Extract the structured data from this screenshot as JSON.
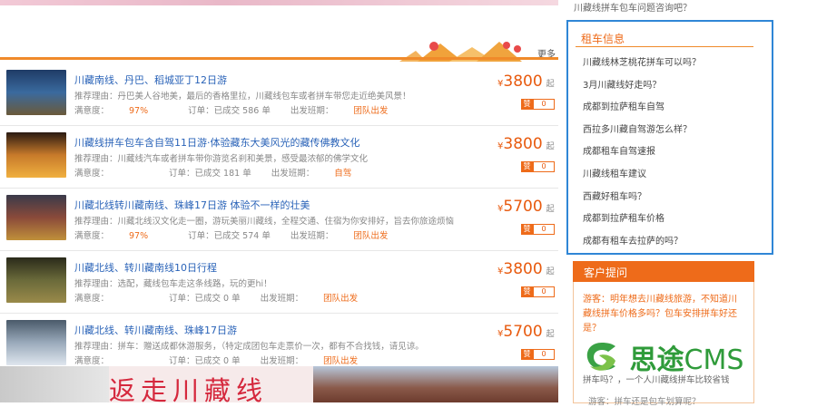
{
  "header": {
    "more": "更多"
  },
  "tours": [
    {
      "title": "川藏南线、丹巴、稻城亚丁12日游",
      "reason": "推荐理由：丹巴美人谷地美，最后的香格里拉，川藏线包车或者拼车带您走近绝美风景！",
      "rate_label": "满意度：",
      "rate": "97%",
      "order": "订单：已成交 586 单",
      "dept_label": "出发班期：",
      "dept": "团队出发",
      "price": "3800",
      "currency": "¥",
      "qi": "起",
      "zan": "赞",
      "likes": "0",
      "colors": [
        "#1f3b66",
        "#3a6a9e",
        "#6b5a3a"
      ]
    },
    {
      "title": "川藏线拼车包车含自驾11日游·体验藏东大美风光的藏传佛教文化",
      "reason": "推荐理由：川藏线汽车或者拼车带你游览名刹和美景，感受最浓郁的佛学文化",
      "rate_label": "满意度：",
      "rate": "",
      "order": "订单：已成交 181 单",
      "dept_label": "出发班期：",
      "dept": "自驾",
      "price": "3800",
      "currency": "¥",
      "qi": "起",
      "zan": "赞",
      "likes": "0",
      "colors": [
        "#2a1a12",
        "#c77a2a",
        "#f0b040"
      ]
    },
    {
      "title": "川藏北线转川藏南线、珠峰17日游 体验不一样的壮美",
      "reason": "推荐理由：川藏北线汉文化走一圈，游玩美丽川藏线，全程交通、住宿为你安排好，旨去你旅途烦恼",
      "rate_label": "满意度：",
      "rate": "97%",
      "order": "订单：已成交 574 单",
      "dept_label": "出发班期：",
      "dept": "团队出发",
      "price": "5700",
      "currency": "¥",
      "qi": "起",
      "zan": "赞",
      "likes": "0",
      "colors": [
        "#3a3a4a",
        "#8a4a3a",
        "#c0903a"
      ]
    },
    {
      "title": "川藏北线、转川藏南线10日行程",
      "reason": "推荐理由：选配，藏线包车走这条线路，玩的更hi！",
      "rate_label": "满意度：",
      "rate": "",
      "order": "订单：已成交 0 单",
      "dept_label": "出发班期：",
      "dept": "团队出发",
      "price": "3800",
      "currency": "¥",
      "qi": "起",
      "zan": "赞",
      "likes": "0",
      "colors": [
        "#2a2a1a",
        "#6a6a3a",
        "#9a8a4a"
      ]
    },
    {
      "title": "川藏北线、转川藏南线、珠峰17日游",
      "reason": "推荐理由：拼车：赠送成都休游服务，（特定成团包车走票价一次，都有不合找钱，请见谅。",
      "rate_label": "满意度：",
      "rate": "",
      "order": "订单：已成交 0 单",
      "dept_label": "出发班期：",
      "dept": "团队出发",
      "price": "5700",
      "currency": "¥",
      "qi": "起",
      "zan": "赞",
      "likes": "0",
      "colors": [
        "#4a5a6a",
        "#9aaabb",
        "#dfe6ee"
      ]
    }
  ],
  "banner": {
    "text": "返走川藏线"
  },
  "sidebar": {
    "top_text": "川藏线拼车包车问题咨询吧？",
    "rent_title": "租车信息",
    "rent_items": [
      "川藏线林芝桃花拼车可以吗？",
      "3月川藏线好走吗？",
      "成都到拉萨租车自驾",
      "西拉多川藏自驾游怎么样？",
      "成都租车自驾速报",
      "川藏线租车建议",
      "西藏好租车吗？",
      "成都到拉萨租车价格",
      "成都有租车去拉萨的吗？"
    ],
    "ask_title": "客户提问",
    "ask_question": "游客：明年想去川藏线旅游，不知道川藏线拼车价格多吗？包车安排拼车好还是？",
    "ask_answer": "拼车吗？，一个人川藏线拼车比较省钱",
    "ask_bottom": "游客：拼车还是包车划算呢？"
  },
  "watermark": {
    "text": "思途",
    "suffix": "CMS"
  }
}
